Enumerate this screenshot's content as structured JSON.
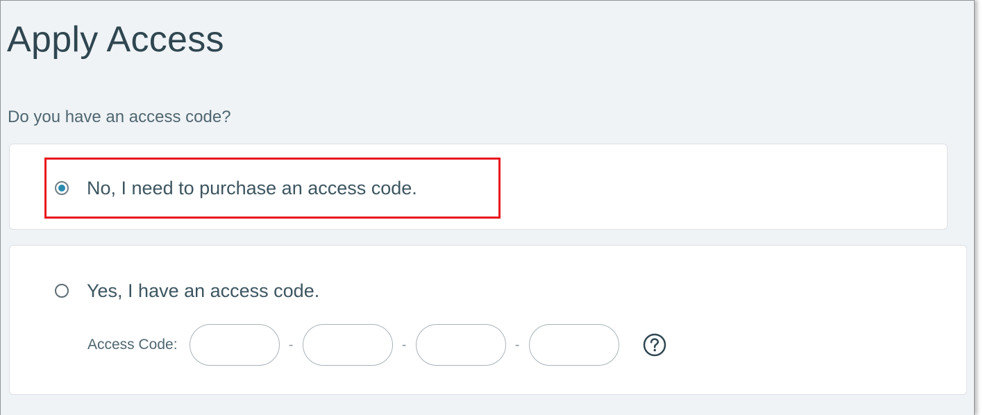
{
  "page": {
    "title": "Apply Access",
    "question": "Do you have an access code?"
  },
  "options": {
    "no": {
      "label": "No, I need to purchase an access code.",
      "selected": true
    },
    "yes": {
      "label": "Yes, I have an access code.",
      "selected": false
    }
  },
  "access_code": {
    "label": "Access Code:",
    "separator": "-",
    "segments": [
      "",
      "",
      "",
      ""
    ],
    "help_icon": "question-circle-icon"
  },
  "colors": {
    "accent": "#2a8bb0",
    "highlight": "#e8151b",
    "background": "#eff3f6",
    "text": "#2f4650"
  }
}
